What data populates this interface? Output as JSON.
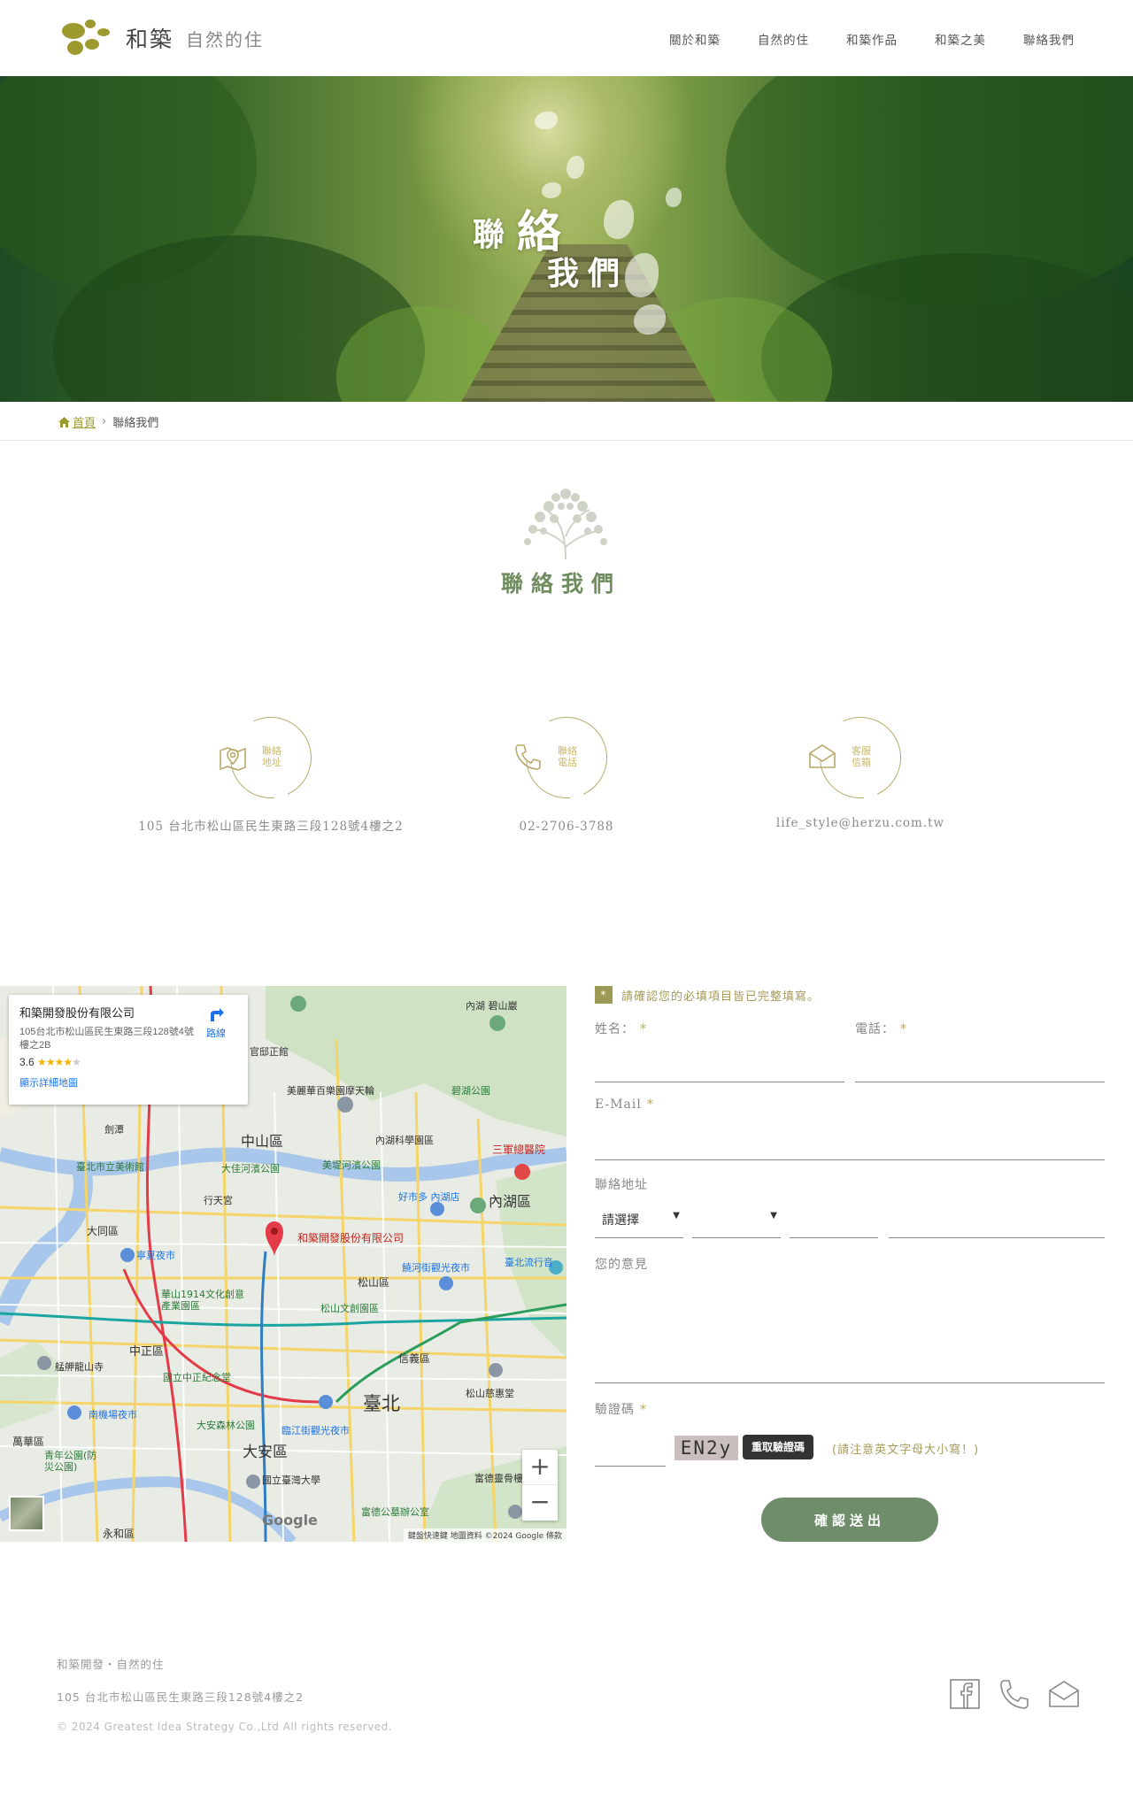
{
  "header": {
    "brand_name": "和築",
    "brand_tagline": "自然的住",
    "nav": [
      "關於和築",
      "自然的住",
      "和築作品",
      "和築之美",
      "聯絡我們"
    ]
  },
  "hero": {
    "title_chars": [
      "聯",
      "絡",
      "我",
      "們"
    ]
  },
  "breadcrumb": {
    "home": "首頁",
    "current": "聯絡我們"
  },
  "section": {
    "title": "聯絡我們"
  },
  "contact_info": [
    {
      "icon": "map-pin-icon",
      "label": "聯絡地址",
      "text": "105 台北市松山區民生東路三段128號4樓之2"
    },
    {
      "icon": "phone-icon",
      "label": "聯絡電話",
      "text": "02-2706-3788"
    },
    {
      "icon": "mail-icon",
      "label": "客服信箱",
      "text": "life_style@herzu.com.tw"
    }
  ],
  "map": {
    "card": {
      "name": "和築開發股份有限公司",
      "address": "105台北市松山區民生東路三段128號4號樓之2B",
      "rating": "3.6",
      "stars": "★★★★",
      "stars_empty": "★",
      "directions": "路線",
      "view_larger": "顯示詳細地圖"
    },
    "pin_label": "和築開發股份有限公司",
    "labels": [
      "內湖 碧山巖",
      "官邸正館",
      "美麗華百樂園摩天輪",
      "碧湖公園",
      "劍潭",
      "中山區",
      "內湖科學園區",
      "三軍總醫院",
      "臺北市立美術館",
      "大佳河濱公園",
      "美堤河濱公園",
      "好市多 內湖店",
      "內湖區",
      "行天宮",
      "大同區",
      "饒河街觀光夜市",
      "寧夏夜市",
      "松山區",
      "臺北流行音",
      "華山1914文化創意產業園區",
      "松山文創園區",
      "信義區",
      "中正區",
      "艋舺龍山寺",
      "國立中正紀念堂",
      "松山慈惠堂",
      "臺北",
      "南機場夜市",
      "大安森林公園",
      "臨江街觀光夜市",
      "大安區",
      "萬華區",
      "青年公園(防災公園)",
      "國立臺灣大學",
      "富德靈骨樓",
      "富德公墓辦公室",
      "永和區"
    ],
    "attribution": "鍵盤快速鍵  地圖資料 ©2024 Google  條款",
    "google": "Google",
    "zoom_in": "+",
    "zoom_out": "−"
  },
  "form": {
    "notice": "請確認您的必填項目皆已完整填寫。",
    "notice_badge": "*",
    "name_label": "姓名：",
    "phone_label": "電話：",
    "email_label": "E-Mail",
    "address_label": "聯絡地址",
    "address_select": "請選擇",
    "opinion_label": "您的意見",
    "captcha_label": "驗證碼",
    "captcha_code": "EN2y",
    "reload_label": "重取驗證碼",
    "captcha_hint": "(請注意英文字母大小寫！)",
    "required_mark": "*",
    "submit_label": "確認送出"
  },
  "footer": {
    "company": "和築開發・自然的住",
    "address": "105 台北市松山區民生東路三段128號4樓之2",
    "copyright": "© 2024 Greatest Idea Strategy Co.,Ltd All rights reserved.",
    "social": [
      "facebook-icon",
      "phone-icon",
      "mail-icon"
    ]
  },
  "colors": {
    "olive": "#9c9a2f",
    "title_green": "#6f8d5f",
    "gold": "#b9a96a",
    "submit_green": "#6f8d6b"
  }
}
